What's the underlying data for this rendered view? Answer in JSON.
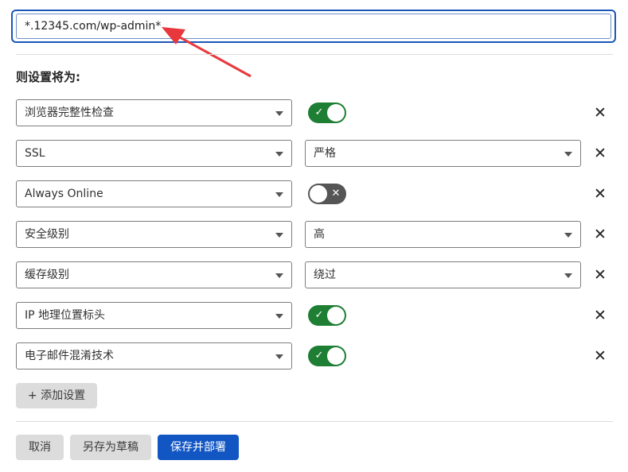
{
  "url_pattern": {
    "value": "*.12345.com/wp-admin*"
  },
  "section_title": "则设置将为:",
  "rules": [
    {
      "setting": "浏览器完整性检查",
      "control": "toggle",
      "toggle_on": true,
      "toggle_symbol": "✓"
    },
    {
      "setting": "SSL",
      "control": "select",
      "value": "严格"
    },
    {
      "setting": "Always Online",
      "control": "toggle",
      "toggle_on": false,
      "toggle_symbol": "✕"
    },
    {
      "setting": "安全级别",
      "control": "select",
      "value": "高"
    },
    {
      "setting": "缓存级别",
      "control": "select",
      "value": "绕过"
    },
    {
      "setting": "IP 地理位置标头",
      "control": "toggle",
      "toggle_on": true,
      "toggle_symbol": "✓"
    },
    {
      "setting": "电子邮件混淆技术",
      "control": "toggle",
      "toggle_on": true,
      "toggle_symbol": "✓"
    }
  ],
  "remove_symbol": "✕",
  "add_setting_label": "+ 添加设置",
  "footer": {
    "cancel_label": "取消",
    "save_draft_label": "另存为草稿",
    "save_deploy_label": "保存并部署"
  },
  "colors": {
    "primary": "#1256c4",
    "toggle_on": "#1e7e34",
    "toggle_off": "#555555",
    "annotation_arrow": "#e8383d"
  }
}
